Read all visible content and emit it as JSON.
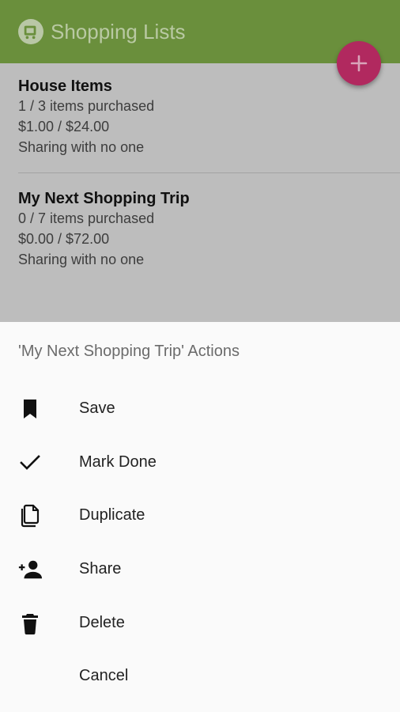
{
  "app": {
    "title": "Shopping Lists",
    "colors": {
      "primary": "#6a8f3c",
      "accent": "#b1295f",
      "sheet": "#fafafa"
    },
    "logo_icon": "shopping-cart-icon",
    "fab_icon": "plus-icon"
  },
  "lists": [
    {
      "name": "House Items",
      "purchased": "1 / 3 items purchased",
      "cost": "$1.00 / $24.00",
      "sharing": "Sharing with no one"
    },
    {
      "name": "My Next Shopping Trip",
      "purchased": "0 / 7 items purchased",
      "cost": "$0.00 / $72.00",
      "sharing": "Sharing with no one"
    }
  ],
  "sheet": {
    "title": "'My Next Shopping Trip' Actions",
    "actions": [
      {
        "label": "Save",
        "icon": "bookmark-icon"
      },
      {
        "label": "Mark Done",
        "icon": "check-icon"
      },
      {
        "label": "Duplicate",
        "icon": "copy-document-icon"
      },
      {
        "label": "Share",
        "icon": "person-add-icon"
      },
      {
        "label": "Delete",
        "icon": "trash-icon"
      },
      {
        "label": "Cancel",
        "icon": ""
      }
    ]
  }
}
